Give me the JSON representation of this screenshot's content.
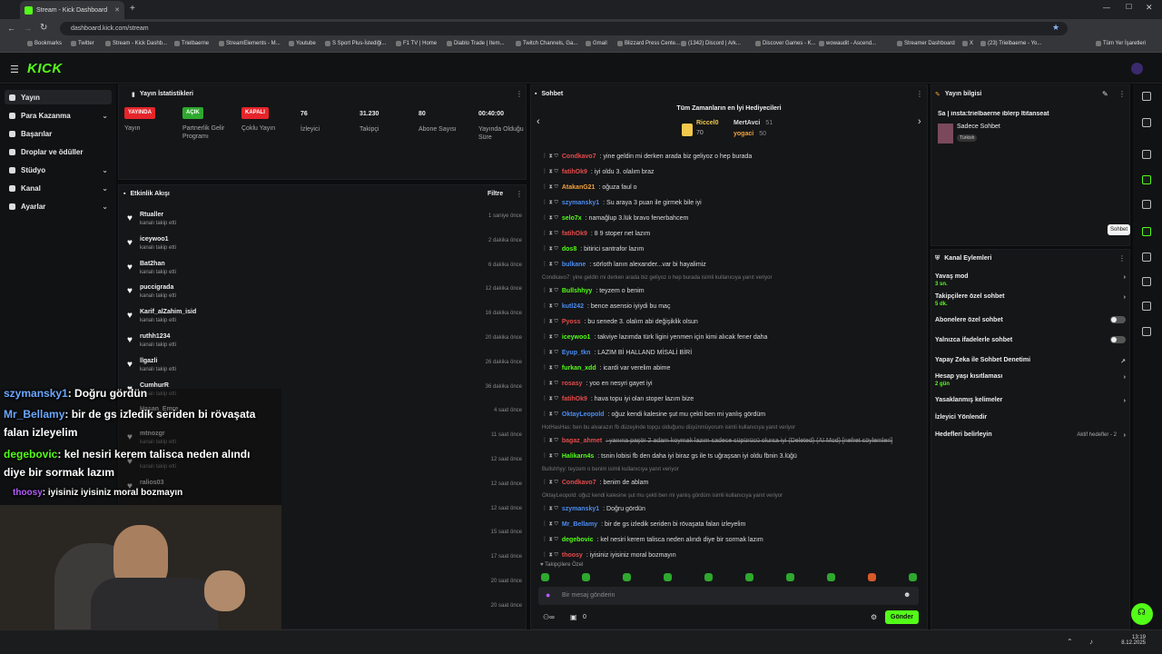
{
  "browser": {
    "tab_title": "Stream - Kick Dashboard",
    "url": "dashboard.kick.com/stream",
    "bookmarks": [
      "Bookmarks",
      "Twitter",
      "Stream - Kick Dashb...",
      "Trielbaerne",
      "StreamElements - M...",
      "Youtube",
      "S Sport Plus-İstediği...",
      "F1 TV | Home",
      "Diablo Trade | Item...",
      "Twitch Channels, Ga...",
      "Gmail",
      "Blizzard Press Cente...",
      "(1342) Discord | Ark...",
      "Discover Games - K...",
      "wowaudit - Ascend...",
      "Streamer Dashboard",
      "X",
      "(23) Trielbaerne - Yo...",
      "Tüm Yer İşaretleri"
    ]
  },
  "brand": {
    "logo": "KICK",
    "accent": "#53fc18"
  },
  "sidebar": {
    "items": [
      {
        "label": "Yayın",
        "icon": "broadcast-icon",
        "active": true
      },
      {
        "label": "Para Kazanma",
        "icon": "money-icon",
        "chevron": true
      },
      {
        "label": "Başarılar",
        "icon": "trophy-icon"
      },
      {
        "label": "Droplar ve ödüller",
        "icon": "gift-icon"
      },
      {
        "label": "Stüdyo",
        "icon": "studio-icon",
        "chevron": true
      },
      {
        "label": "Kanal",
        "icon": "channel-icon",
        "chevron": true
      },
      {
        "label": "Ayarlar",
        "icon": "gear-icon",
        "chevron": true
      }
    ]
  },
  "stats": {
    "title": "Yayın İstatistikleri",
    "items": [
      {
        "badge": "YAYINDA",
        "badge_color": "#e5252a",
        "label": "Yayın"
      },
      {
        "badge": "AÇIK",
        "badge_color": "#2ea82e",
        "label": "Partnerlik Gelir Programı"
      },
      {
        "badge": "KAPALI",
        "badge_color": "#e5252a",
        "label": "Çoklu Yayın"
      },
      {
        "value": "76",
        "label": "İzleyici"
      },
      {
        "value": "31.230",
        "label": "Takipçi"
      },
      {
        "value": "80",
        "label": "Abone Sayısı"
      },
      {
        "value": "00:40:00",
        "label": "Yayında Olduğu Süre"
      }
    ]
  },
  "feed": {
    "title": "Etkinlik Akışı",
    "filter": "Filtre",
    "items": [
      {
        "name": "Rtualler",
        "sub": "kanalı takip etti",
        "time": "1 saniye önce"
      },
      {
        "name": "iceywoo1",
        "sub": "kanalı takip etti",
        "time": "2 dakika önce"
      },
      {
        "name": "Bat2han",
        "sub": "kanalı takip etti",
        "time": "6 dakika önce"
      },
      {
        "name": "puccigrada",
        "sub": "kanalı takip etti",
        "time": "12 dakika önce"
      },
      {
        "name": "Karif_alZahim_isid",
        "sub": "kanalı takip etti",
        "time": "16 dakika önce"
      },
      {
        "name": "ruthh1234",
        "sub": "kanalı takip etti",
        "time": "20 dakika önce"
      },
      {
        "name": "llgazli",
        "sub": "kanalı takip etti",
        "time": "26 dakika önce"
      },
      {
        "name": "CumhurR",
        "sub": "kanalı takip etti",
        "time": "36 dakika önce"
      },
      {
        "name": "Hasan_Emre",
        "sub": "kanalı takip etti",
        "time": "4 saat önce"
      },
      {
        "name": "mtnozgr",
        "sub": "kanalı takip etti",
        "time": "11 saat önce"
      },
      {
        "name": "",
        "sub": "kanalı takip etti",
        "time": "12 saat önce"
      },
      {
        "name": "ralios03",
        "sub": "",
        "time": "12 saat önce"
      },
      {
        "name": "",
        "sub": "",
        "time": "12 saat önce"
      },
      {
        "name": "",
        "sub": "",
        "time": "15 saat önce"
      },
      {
        "name": "",
        "sub": "",
        "time": "17 saat önce"
      },
      {
        "name": "",
        "sub": "",
        "time": "20 saat önce"
      },
      {
        "name": "",
        "sub": "",
        "time": "20 saat önce"
      }
    ]
  },
  "chat": {
    "title": "Sohbet",
    "top_gifters_title": "Tüm Zamanların en İyi Hediyecileri",
    "top_gifters": [
      {
        "name": "Riccel0",
        "count": "70",
        "color": "#f2c94c"
      },
      {
        "name": "MertAvci",
        "count": "51",
        "color": "#ddd"
      },
      {
        "name": "yogaci",
        "count": "50",
        "color": "#f2a13c"
      }
    ],
    "messages": [
      {
        "user": "Condkavo7",
        "color": "#e24b4b",
        "text": ": yine geldin mi derken   arada biz geliyoz o hep burada"
      },
      {
        "user": "fatihOk9",
        "color": "#e24b4b",
        "text": ": iyi oldu 3. olalım braz"
      },
      {
        "user": "AtakanG21",
        "color": "#f2a13c",
        "text": ": oğuza faul o"
      },
      {
        "user": "szymansky1",
        "color": "#4b8cf2",
        "text": ": Su araya 3 puan ile girmek bile iyi"
      },
      {
        "user": "selo7x",
        "color": "#53fc18",
        "text": ": namağlup 3.lük bravo fenerbahcem"
      },
      {
        "user": "fatihOk9",
        "color": "#e24b4b",
        "text": ": 8 9 stoper net lazım"
      },
      {
        "user": "dos8",
        "color": "#53fc18",
        "text": ": bitirici santrafor lazım"
      },
      {
        "user": "bulkane",
        "color": "#4b8cf2",
        "text": ": sörloth lanın alexander...var bi hayalimiz"
      },
      {
        "reply": "Condkavo7: yine geldin mi derken   arada biz geliyoz o hep burada isimli kullanıcıya yanıt veriyor"
      },
      {
        "user": "Bullshhyy",
        "color": "#53fc18",
        "text": ": teyzem o benim"
      },
      {
        "user": "kutl242",
        "color": "#4b8cf2",
        "text": ": bence asensio iyiydi bu maç"
      },
      {
        "user": "Pyoss",
        "color": "#e24b4b",
        "text": ": bu senede 3. olalım abi değişiklik olsun"
      },
      {
        "user": "iceywoo1",
        "color": "#53fc18",
        "text": ": takviye lazımda türk ligini yenmen için kimi alıcak fener daha"
      },
      {
        "user": "Eyup_tkn",
        "color": "#4b8cf2",
        "text": ": LAZIM Bİ HALLAND MİSALİ BİRİ"
      },
      {
        "user": "furkan_xdd",
        "color": "#53fc18",
        "text": ": icardi var verelim abime"
      },
      {
        "user": "rosasy",
        "color": "#e24b4b",
        "text": ": yoo en nesyri gayet iyi"
      },
      {
        "user": "fatihOk9",
        "color": "#e24b4b",
        "text": ": hava topu iyi olan stoper lazım bize"
      },
      {
        "user": "OktayLeopold",
        "color": "#4b8cf2",
        "text": ": oğuz kendi kalesine şut mu çekti ben mi yanlış gördüm"
      },
      {
        "reply": "HotHasHas: ben bu alvarazın fb düzeyinde topçu olduğunu düşünmüyorum isimli kullanıcıya yanıt veriyor"
      },
      {
        "user": "bagaz_ahmet",
        "color": "#e24b4b",
        "text": ": yanına paşör 2 adam koymak lazım sadece süpürücü olursa iyi (Deleted) (AI Mod) [nefret söylemleri]",
        "struck": true
      },
      {
        "user": "Halikarn4s",
        "color": "#53fc18",
        "text": ": tsnin lobisi fb den daha iyi biraz gs ile ts uğraşsan   iyi oldu fbnin 3.lüğü"
      },
      {
        "reply": "Bullshhyy: teyzem o benim isimli kullanıcıya yanıt veriyor"
      },
      {
        "user": "Condkavo7",
        "color": "#e24b4b",
        "text": ": benim de ablam"
      },
      {
        "reply": "OktayLeopold: oğuz kendi kalesine şut mu çekti ben mi yanlış gördüm isimli kullanıcıya yanıt veriyor"
      },
      {
        "user": "szymansky1",
        "color": "#4b8cf2",
        "text": ": Doğru gördün"
      },
      {
        "user": "Mr_Bellamy",
        "color": "#4b8cf2",
        "text": ": bir de gs izledik seriden bi rövaşata falan izleyelim"
      },
      {
        "user": "degebovic",
        "color": "#53fc18",
        "text": ": kel nesiri kerem talisca neden alındı diye bir sormak lazım"
      },
      {
        "user": "thoosy",
        "color": "#e24b4b",
        "text": ": iyisiniz iyisiniz moral bozmayın"
      }
    ],
    "followers_only_note": "Takipçilere Özel",
    "input_placeholder": "Bir mesaj gönderin",
    "send_label": "Gönder",
    "bottom_count": "0"
  },
  "stream_info": {
    "title": "Yayın bilgisi",
    "stream_title": "Sa | insta:trielbaerne iblerp Ititanseat",
    "category": "Sadece Sohbet",
    "language": "Türkish",
    "tooltip": "Sohbet"
  },
  "channel_actions": {
    "title": "Kanal Eylemleri",
    "items": [
      {
        "label": "Yavaş mod",
        "sub": "3 sn.",
        "type": "chevron"
      },
      {
        "label": "Takipçilere özel sohbet",
        "sub": "5 dk.",
        "type": "chevron"
      },
      {
        "label": "Abonelere özel sohbet",
        "type": "toggle"
      },
      {
        "label": "Yalnızca ifadelerle sohbet",
        "type": "toggle"
      },
      {
        "label": "Yapay Zeka ile Sohbet Denetimi",
        "type": "link"
      },
      {
        "label": "Hesap yaşı kısıtlaması",
        "sub": "2 gün",
        "type": "chevron"
      },
      {
        "label": "Yasaklanmış kelimeler",
        "type": "chevron"
      },
      {
        "label": "İzleyici Yönlendir",
        "type": "none"
      },
      {
        "label": "Hedefleri belirleyin",
        "extra": "Aktif hedefler - 2",
        "type": "chevron"
      }
    ]
  },
  "overlay": {
    "lines": [
      {
        "user": "szymansky1",
        "color": "#6aa8ff",
        "text": ": Doğru gördün"
      },
      {
        "user": "Mr_Bellamy",
        "color": "#6aa8ff",
        "text": ": bir de gs izledik seriden bi rövaşata"
      },
      {
        "user": "",
        "color": "#fff",
        "text": "falan izleyelim"
      },
      {
        "user": "degebovic",
        "color": "#53fc18",
        "text": ": kel nesiri kerem talisca neden alındı"
      },
      {
        "user": "",
        "color": "#fff",
        "text": "diye bir sormak lazım"
      },
      {
        "user": "thoosy",
        "color": "#b45cff",
        "text": ": iyisiniz iyisiniz moral bozmayın"
      }
    ]
  },
  "taskbar": {
    "time": "13:19",
    "date": "8.12.2025"
  }
}
